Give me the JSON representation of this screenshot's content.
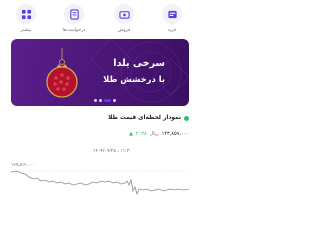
{
  "quick_actions": [
    {
      "label": "بیشتر",
      "icon": "grid-icon"
    },
    {
      "label": "درخواست‌ها",
      "icon": "requests-icon"
    },
    {
      "label": "فروش",
      "icon": "sell-icon"
    },
    {
      "label": "خرید",
      "icon": "buy-icon"
    }
  ],
  "banner": {
    "line1": "سرخی یلدا",
    "line2": "با درخشش طلا",
    "active_slide": 3,
    "slide_count": 4
  },
  "chart": {
    "title": "نمودار لحظه‌ای قیمت طلا",
    "price": "۱۴۳,۸۵۹,۰۰۰",
    "unit": "ریال",
    "change": "۲۰۳۸",
    "timestamp": "۱۴۰۴/۰۹/۲۵ ، ۱۱:۳۰",
    "y_top_label": "۱۳۹,۵۱۲,۰۰۰",
    "line_color": "#8c8c96",
    "live_color": "#2fbf71"
  },
  "colors": {
    "banner_purple": "#4a1677",
    "accent_purple": "#5a3fd6",
    "positive_green": "#2fbf71"
  }
}
